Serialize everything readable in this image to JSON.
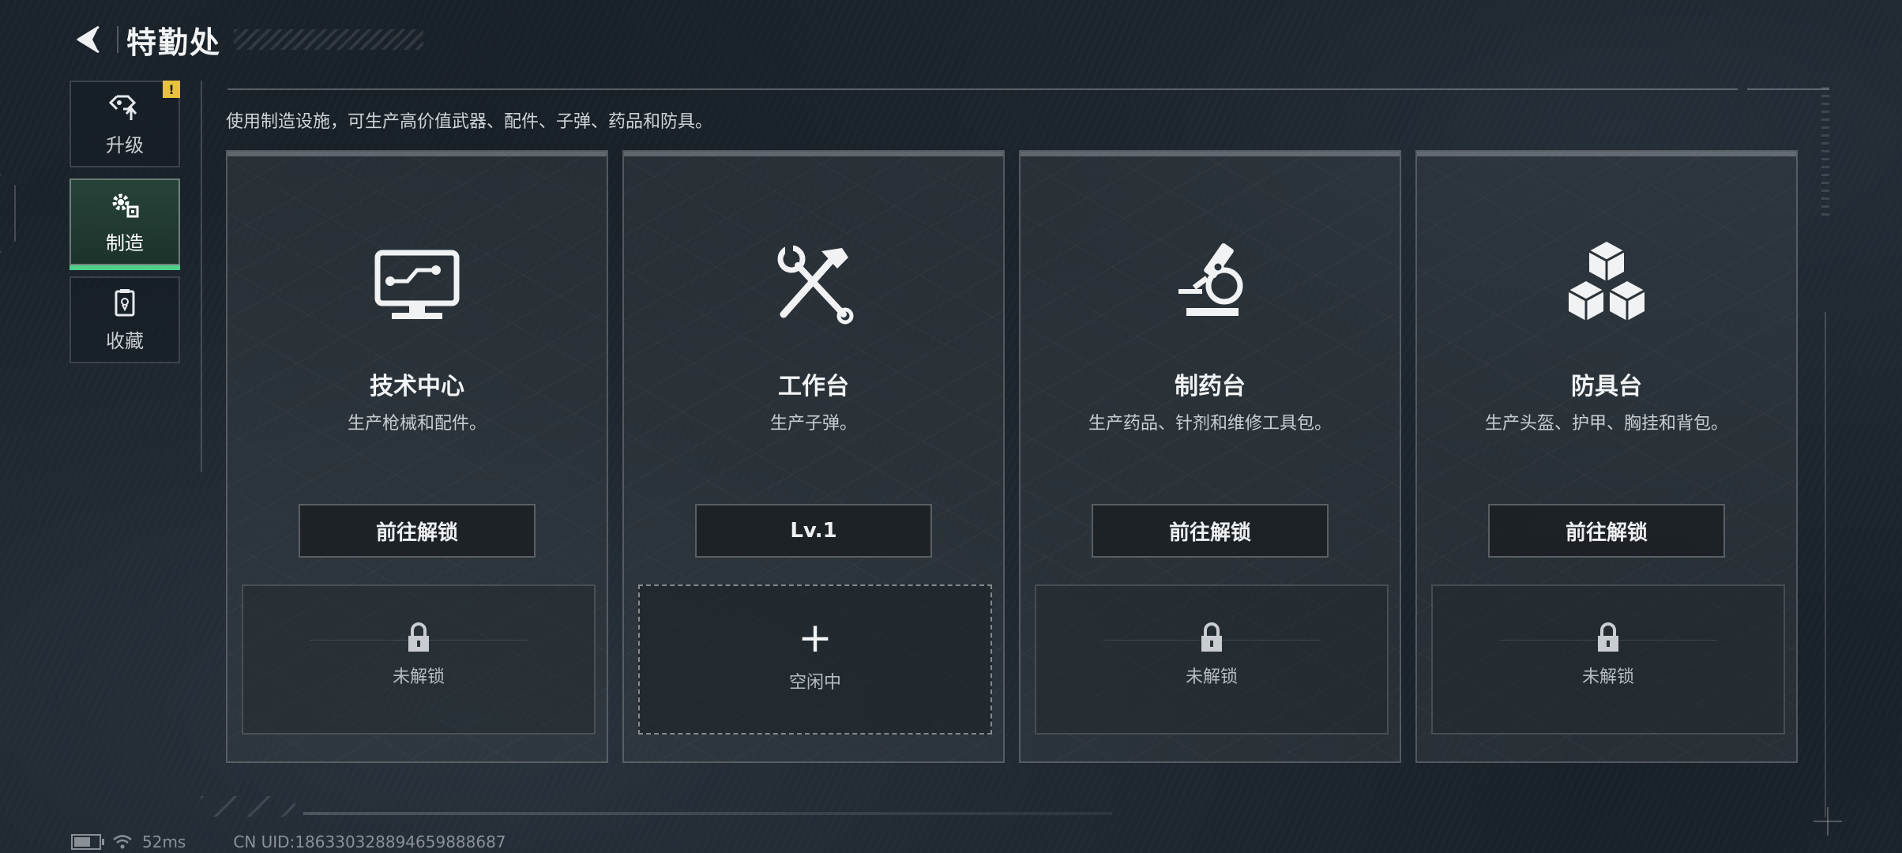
{
  "header": {
    "title": "特勤处"
  },
  "sidebar": {
    "items": [
      {
        "label": "升级",
        "icon": "upgrade-icon",
        "badge": "!"
      },
      {
        "label": "制造",
        "icon": "gears-icon",
        "active": true
      },
      {
        "label": "收藏",
        "icon": "collection-icon"
      }
    ]
  },
  "main": {
    "description": "使用制造设施，可生产高价值武器、配件、子弹、药品和防具。",
    "cards": [
      {
        "title": "技术中心",
        "subtitle": "生产枪械和配件。",
        "button": "前往解锁",
        "slot": "未解锁",
        "icon": "computer-icon",
        "slot_state": "locked"
      },
      {
        "title": "工作台",
        "subtitle": "生产子弹。",
        "button": "Lv.1",
        "slot": "空闲中",
        "icon": "hammer-wrench-icon",
        "slot_state": "idle",
        "slot_symbol": "+"
      },
      {
        "title": "制药台",
        "subtitle": "生产药品、针剂和维修工具包。",
        "button": "前往解锁",
        "slot": "未解锁",
        "icon": "microscope-icon",
        "slot_state": "locked"
      },
      {
        "title": "防具台",
        "subtitle": "生产头盔、护甲、胸挂和背包。",
        "button": "前往解锁",
        "slot": "未解锁",
        "icon": "cubes-icon",
        "slot_state": "locked"
      }
    ]
  },
  "status": {
    "ping": "52ms",
    "uid": "CN UID:18633032889465988868​7",
    "battery_level": 0.6
  },
  "colors": {
    "accent_green": "#4ecf8a",
    "alert_yellow": "#e7c23b"
  }
}
